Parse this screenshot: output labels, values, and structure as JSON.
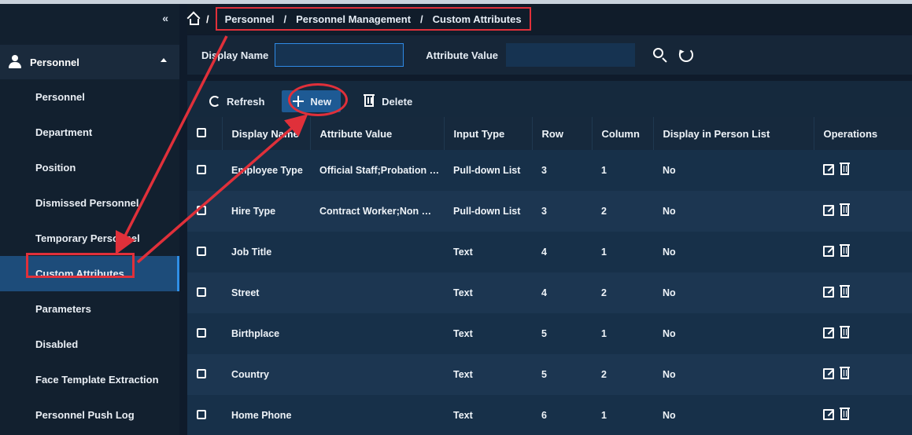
{
  "sidebar": {
    "collapse_glyph": "«",
    "section_label": "Personnel",
    "items": [
      {
        "label": "Personnel"
      },
      {
        "label": "Department"
      },
      {
        "label": "Position"
      },
      {
        "label": "Dismissed Personnel"
      },
      {
        "label": "Temporary Personnel"
      },
      {
        "label": "Custom Attributes",
        "active": true
      },
      {
        "label": "Parameters"
      },
      {
        "label": "Disabled"
      },
      {
        "label": "Face Template Extraction"
      },
      {
        "label": "Personnel Push Log"
      }
    ]
  },
  "breadcrumb": {
    "root_sep": "/",
    "items": [
      "Personnel",
      "Personnel Management",
      "Custom Attributes"
    ],
    "sep": "/"
  },
  "filter": {
    "display_name_label": "Display Name",
    "display_name_value": "",
    "attribute_value_label": "Attribute Value",
    "attribute_value_value": ""
  },
  "toolbar": {
    "refresh_label": "Refresh",
    "new_label": "New",
    "delete_label": "Delete"
  },
  "table": {
    "columns": [
      "Display Name",
      "Attribute Value",
      "Input Type",
      "Row",
      "Column",
      "Display in Person List",
      "Operations"
    ],
    "rows": [
      {
        "display_name": "Employee Type",
        "attribute_value": "Official Staff;Probation …",
        "input_type": "Pull-down List",
        "row": "3",
        "column": "1",
        "display": "No"
      },
      {
        "display_name": "Hire Type",
        "attribute_value": "Contract Worker;Non …",
        "input_type": "Pull-down List",
        "row": "3",
        "column": "2",
        "display": "No"
      },
      {
        "display_name": "Job Title",
        "attribute_value": "",
        "input_type": "Text",
        "row": "4",
        "column": "1",
        "display": "No"
      },
      {
        "display_name": "Street",
        "attribute_value": "",
        "input_type": "Text",
        "row": "4",
        "column": "2",
        "display": "No"
      },
      {
        "display_name": "Birthplace",
        "attribute_value": "",
        "input_type": "Text",
        "row": "5",
        "column": "1",
        "display": "No"
      },
      {
        "display_name": "Country",
        "attribute_value": "",
        "input_type": "Text",
        "row": "5",
        "column": "2",
        "display": "No"
      },
      {
        "display_name": "Home Phone",
        "attribute_value": "",
        "input_type": "Text",
        "row": "6",
        "column": "1",
        "display": "No"
      }
    ]
  },
  "colors": {
    "accent": "#1e5a94",
    "annotation": "#e0303a",
    "active_item": "#1d4c7a"
  }
}
